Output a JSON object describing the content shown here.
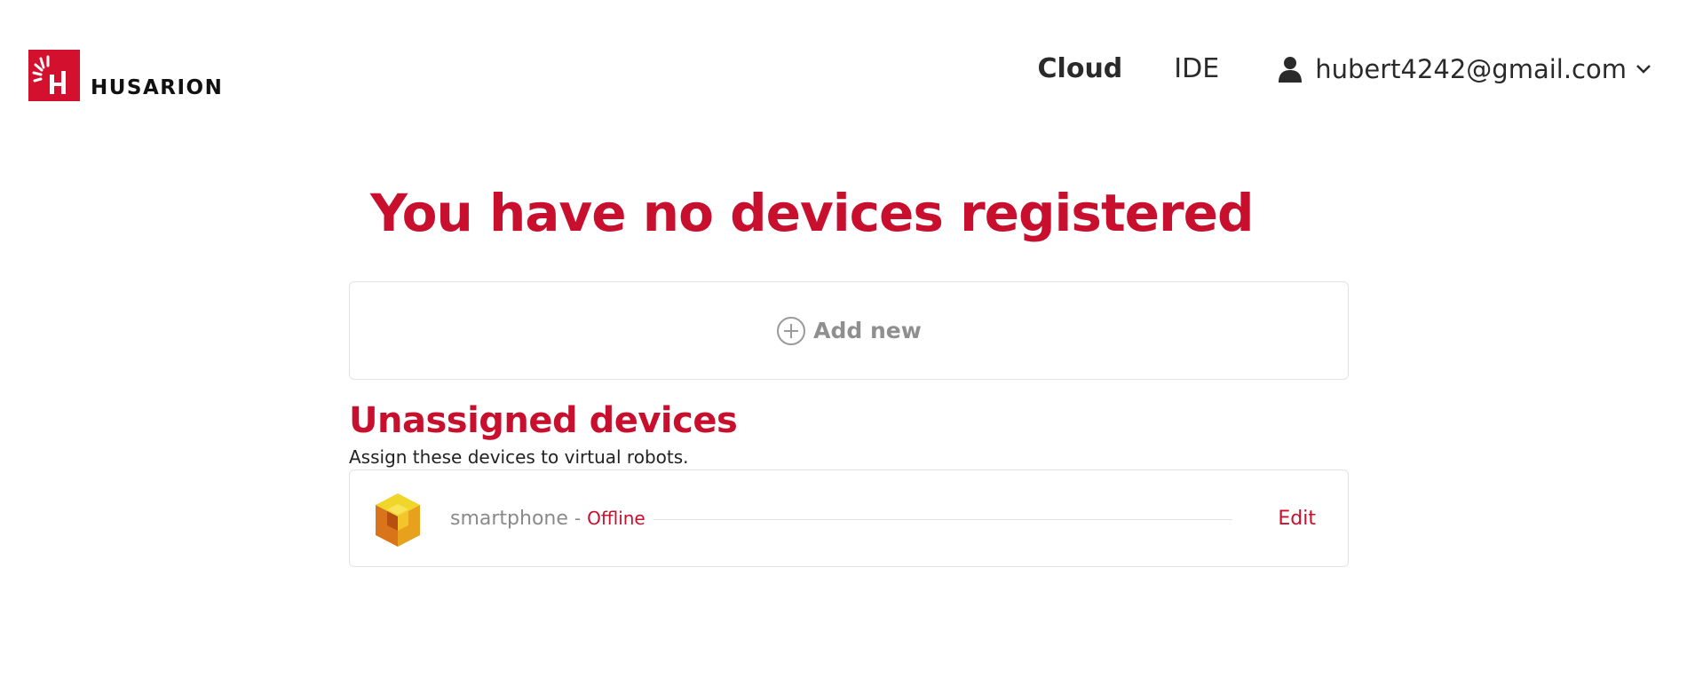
{
  "brand": {
    "name": "HUSARION",
    "color": "#d3102e"
  },
  "nav": {
    "items": [
      {
        "label": "Cloud",
        "active": true
      },
      {
        "label": "IDE",
        "active": false
      }
    ],
    "user": {
      "email": "hubert4242@gmail.com",
      "icon": "user-icon",
      "dropdown_icon": "chevron-down-icon"
    }
  },
  "main": {
    "title": "You have no devices registered",
    "add_new": {
      "label": "Add new",
      "icon": "plus-circle-icon"
    }
  },
  "unassigned": {
    "title": "Unassigned devices",
    "subtitle": "Assign these devices to virtual robots.",
    "devices": [
      {
        "name": "smartphone",
        "separator": "-",
        "status": "Offline",
        "action": "Edit",
        "icon": "device-cube-icon"
      }
    ]
  },
  "colors": {
    "accent": "#c8102e",
    "muted_text": "#8a8a8a",
    "border": "#e2e2e2"
  }
}
